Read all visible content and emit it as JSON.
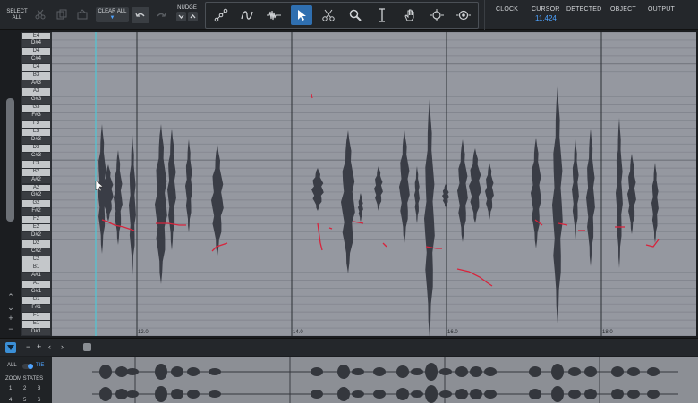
{
  "toolbar": {
    "select_all": [
      "SELECT",
      "ALL"
    ],
    "clear_all": "CLEAR ALL",
    "nudge": "NUDGE",
    "clock": "CLOCK",
    "cursor_label": "CURSOR",
    "cursor_value": "11.424",
    "detected": "DETECTED",
    "object": "OBJECT",
    "output": "OUTPUT",
    "active_tool": "pointer-tool"
  },
  "piano_keys": [
    "E4",
    "D#4",
    "D4",
    "C#4",
    "C4",
    "B3",
    "A#3",
    "A3",
    "G#3",
    "G3",
    "F#3",
    "F3",
    "E3",
    "D#3",
    "D3",
    "C#3",
    "C3",
    "B2",
    "A#2",
    "A2",
    "G#2",
    "G2",
    "F#2",
    "F2",
    "E2",
    "D#2",
    "D2",
    "C#2",
    "C2",
    "B1",
    "A#1",
    "A1",
    "G#1",
    "G1",
    "F#1",
    "F1",
    "E1",
    "D#1"
  ],
  "timeline": {
    "labels": [
      "12.0",
      "14.0",
      "16.0",
      "18.0"
    ]
  },
  "overview_panel": {
    "all_label": "ALL",
    "tie_label": "TIE",
    "zoom_states_label": "ZOOM STATES",
    "zoom_states": [
      "1",
      "2",
      "3"
    ],
    "zoom_states_row2": [
      "4",
      "5",
      "6"
    ]
  },
  "colors": {
    "accent": "#2f6fb0",
    "cursor_value": "#4ea3ff",
    "playhead": "#4fc7d6",
    "pitch_curve": "#d8243c",
    "waveform": "#3a3d46",
    "grid_bg": "#9598a0"
  }
}
